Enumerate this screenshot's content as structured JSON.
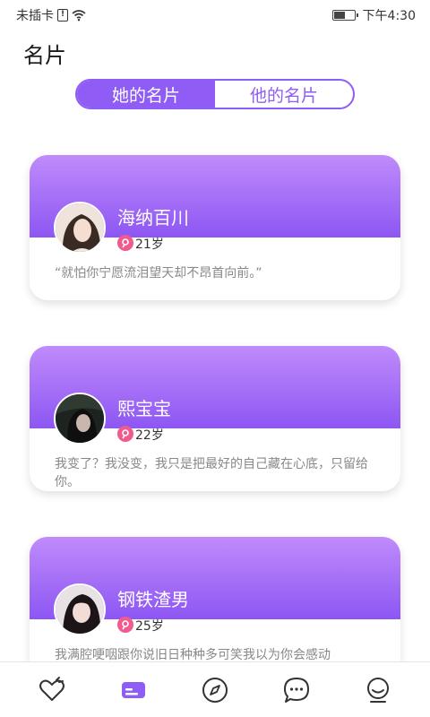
{
  "status": {
    "carrier": "未插卡",
    "sim_symbol": "!",
    "time": "下午4:30",
    "battery_level": 0.5
  },
  "header": {
    "title": "名片"
  },
  "tabs": [
    {
      "label": "她的名片",
      "active": true
    },
    {
      "label": "他的名片",
      "active": false
    }
  ],
  "cards": [
    {
      "name": "海纳百川",
      "age": "21岁",
      "quote": "“就怕你宁愿流泪望天却不昂首向前。”"
    },
    {
      "name": "熙宝宝",
      "age": "22岁",
      "quote": "我变了？我没变，我只是把最好的自己藏在心底，只留给你。"
    },
    {
      "name": "钢铁渣男",
      "age": "25岁",
      "quote": "我满腔哽咽跟你说旧日种种多可笑我以为你会感动"
    }
  ],
  "nav": {
    "items": [
      "heart-icon",
      "card-icon",
      "compass-icon",
      "chat-icon",
      "profile-icon"
    ],
    "active_index": 1
  },
  "colors": {
    "accent": "#8f5cf5",
    "gradient_top": "#c08bfb",
    "gradient_bottom": "#8d56f3",
    "female_badge": "#f05a8f",
    "nav_icon": "#333333"
  }
}
